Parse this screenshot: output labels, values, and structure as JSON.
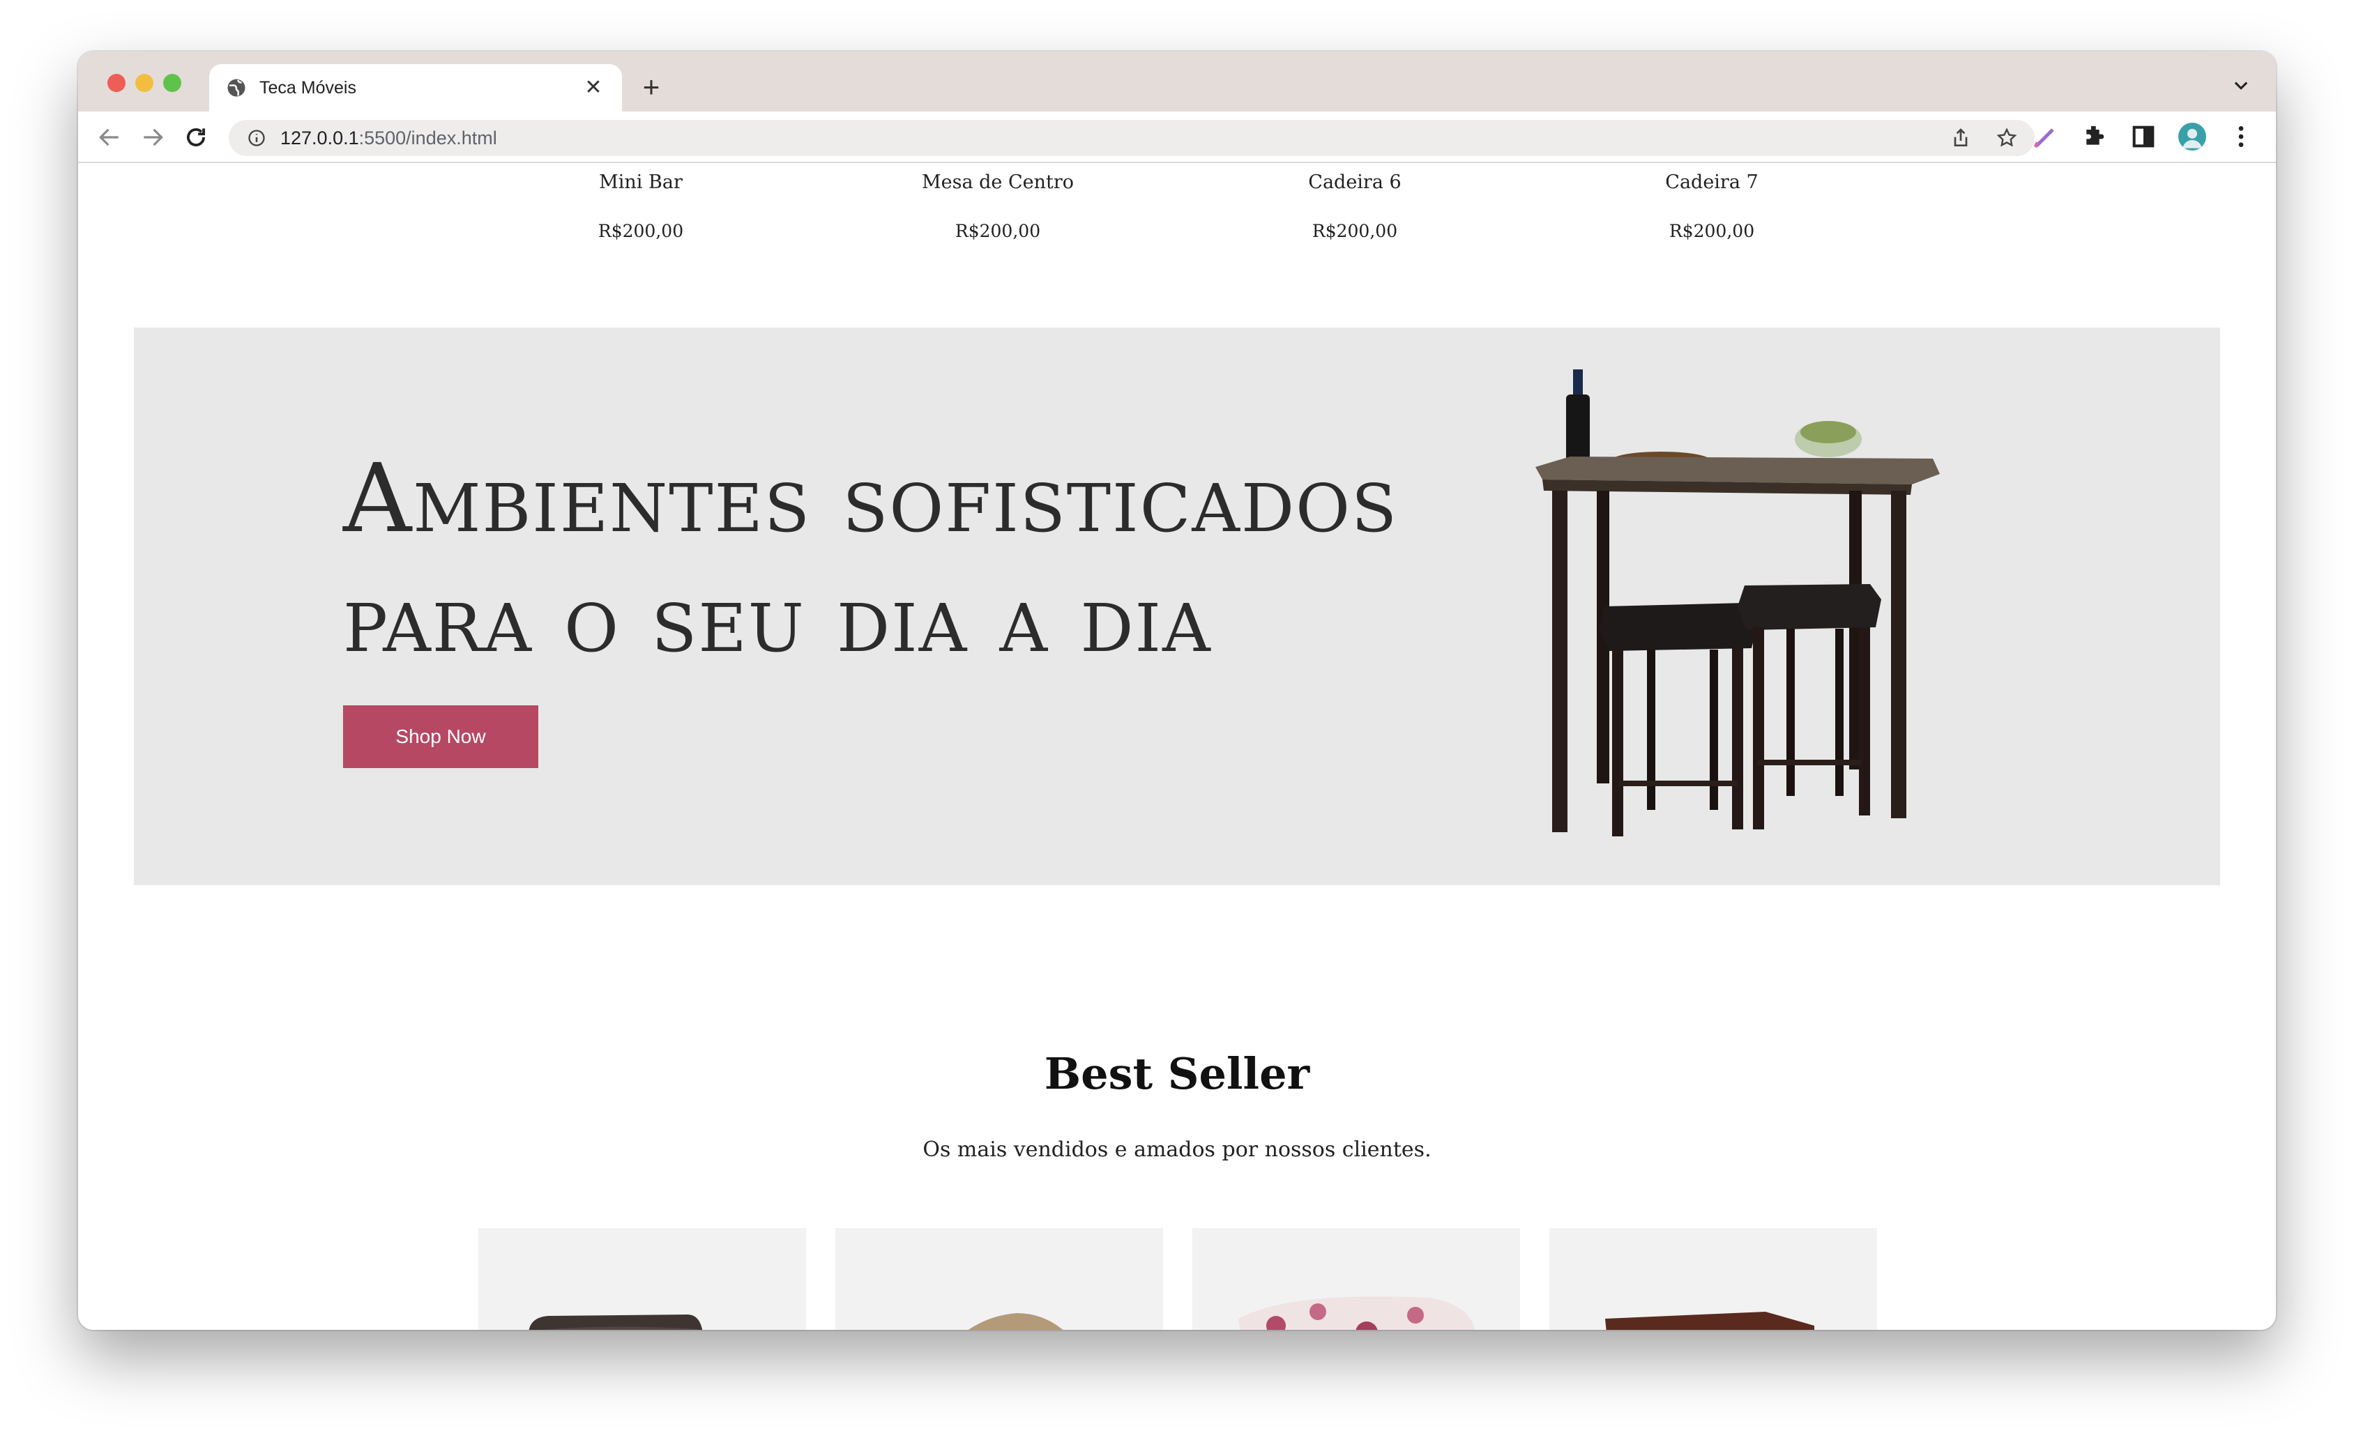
{
  "browser": {
    "tab_title": "Teca Móveis",
    "tab_close": "✕",
    "new_tab": "+",
    "url_host": "127.0.0.1",
    "url_rest": ":5500/index.html"
  },
  "top_products": [
    {
      "name": "Mini Bar",
      "price": "R$200,00"
    },
    {
      "name": "Mesa de Centro",
      "price": "R$200,00"
    },
    {
      "name": "Cadeira 6",
      "price": "R$200,00"
    },
    {
      "name": "Cadeira 7",
      "price": "R$200,00"
    }
  ],
  "banner": {
    "line1": "Ambientes sofisticados",
    "line2": "para o seu dia a dia",
    "button": "Shop Now"
  },
  "best_seller": {
    "title": "Best Seller",
    "subtitle": "Os mais vendidos e amados por nossos clientes."
  },
  "colors": {
    "accent": "#b74863",
    "banner_bg": "#e8e8e8",
    "card_bg": "#f2f2f2"
  }
}
